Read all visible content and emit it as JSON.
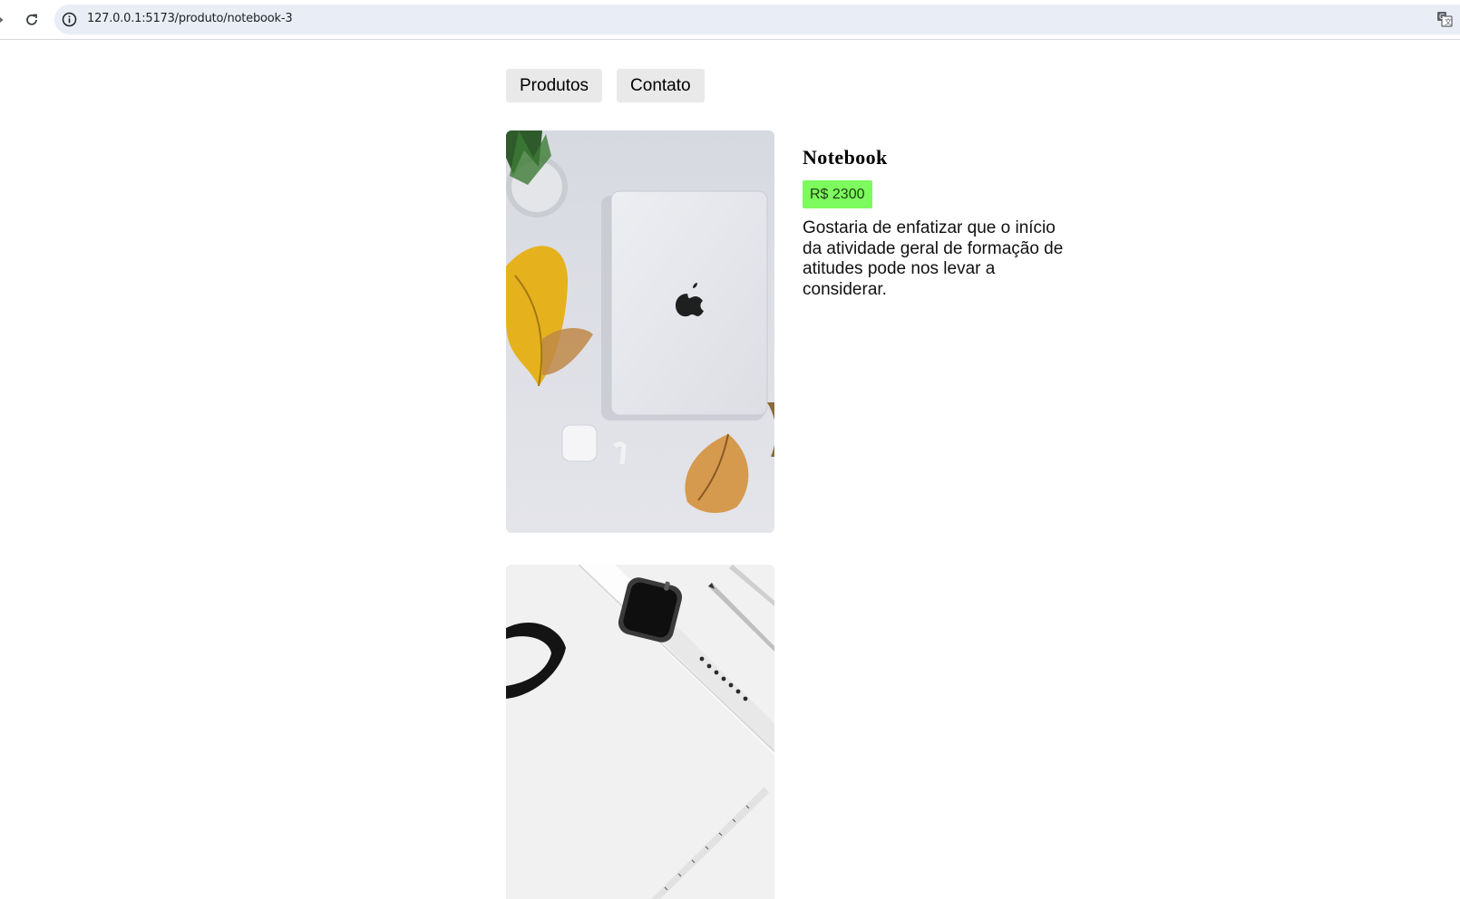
{
  "browser": {
    "url": "127.0.0.1:5173/produto/notebook-3"
  },
  "nav": {
    "products_label": "Produtos",
    "contact_label": "Contato"
  },
  "product": {
    "name": "Notebook",
    "price": "R$ 2300",
    "description": "Gostaria de enfatizar que o início da atividade geral de formação de atitudes pode nos levar a considerar.",
    "price_badge_color": "#7dfa5d"
  },
  "gallery": {
    "images": [
      {
        "icon": "laptop-photo"
      },
      {
        "icon": "smartwatch-photo"
      }
    ]
  }
}
